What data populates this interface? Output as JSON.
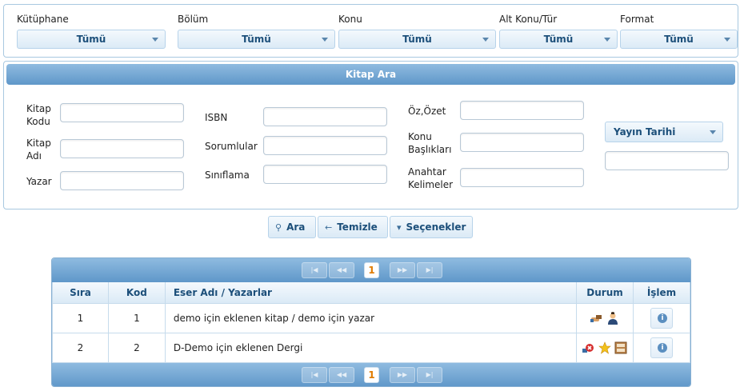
{
  "filters": [
    {
      "label": "Kütüphane",
      "value": "Tümü"
    },
    {
      "label": "Bölüm",
      "value": "Tümü"
    },
    {
      "label": "Konu",
      "value": "Tümü"
    },
    {
      "label": "Alt Konu/Tür",
      "value": "Tümü"
    },
    {
      "label": "Format",
      "value": "Tümü"
    }
  ],
  "search": {
    "title": "Kitap Ara",
    "fields": {
      "kitap_kodu": "Kitap Kodu",
      "kitap_adi": "Kitap Adı",
      "yazar": "Yazar",
      "isbn": "ISBN",
      "sorumlular": "Sorumlular",
      "siniflama": "Sınıflama",
      "oz_ozet": "Öz,Özet",
      "konu_basliklari": "Konu Başlıkları",
      "anahtar_kelimeler": "Anahtar Kelimeler"
    },
    "date_select": "Yayın Tarihi"
  },
  "actions": {
    "search": "Ara",
    "clear": "Temizle",
    "options": "Seçenekler"
  },
  "grid": {
    "current_page": "1",
    "columns": [
      "Sıra",
      "Kod",
      "Eser Adı / Yazarlar",
      "Durum",
      "İşlem"
    ],
    "rows": [
      {
        "sira": "1",
        "kod": "1",
        "eser": "demo için eklenen kitap / demo için yazar",
        "status_icons": [
          "hand-book-icon",
          "person-icon"
        ]
      },
      {
        "sira": "2",
        "kod": "2",
        "eser": "D-Demo için eklenen Dergi",
        "status_icons": [
          "error-badge-icon",
          "star-icon",
          "shelf-icon"
        ]
      }
    ]
  },
  "colors": {
    "accent": "#5f97c9",
    "border": "#a8c8e0",
    "page_highlight": "#e07b00"
  }
}
